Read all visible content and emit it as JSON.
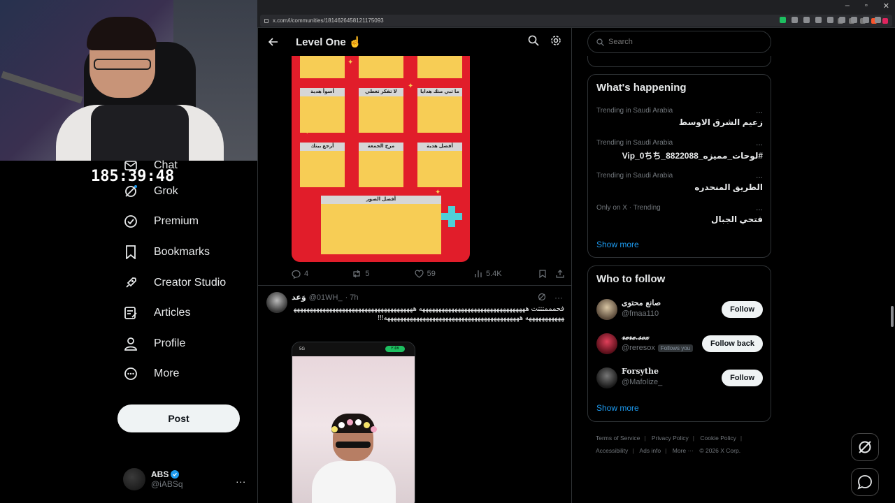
{
  "browser": {
    "url": "x.com/i/communities/1814626458121175093",
    "window_controls": [
      "–",
      "▫",
      "✕"
    ]
  },
  "stream": {
    "timer": "185:39:48"
  },
  "nav": {
    "chat": "Chat",
    "grok": "Grok",
    "premium": "Premium",
    "bookmarks": "Bookmarks",
    "creator_studio": "Creator Studio",
    "articles": "Articles",
    "profile": "Profile",
    "more": "More",
    "post": "Post"
  },
  "account": {
    "display_name": "ABS",
    "handle": "@iABSq",
    "more": "..."
  },
  "header": {
    "title": "Level One ☝️"
  },
  "post1": {
    "cells": [
      "أسوأ هدية",
      "لا تفكر تغطي",
      "ما تبي منك هدايا",
      "أرجع بيتك",
      "مرح الجمعة",
      "أفضل هدية",
      "أفضل الصور"
    ],
    "replies": "4",
    "reposts": "5",
    "likes": "59",
    "views": "5.4K"
  },
  "post2": {
    "name": "وَعد",
    "handle": "@01WH_",
    "time": "· 7h",
    "text": "فحمممتتتت هههههههههههههههههههههههههههههههههه هههههههههههههههههههههههههههههههههههههههههههههههههه ههههههههههههههههههههههههههههههههههههههههههه!!!",
    "phone_signal": "5G",
    "phone_pill": "٢:٥٧"
  },
  "search": {
    "placeholder": "Search"
  },
  "trending": {
    "title": "What's happening",
    "items": [
      {
        "context": "Trending in Saudi Arabia",
        "topic": "زعيم الشرق الاوسط"
      },
      {
        "context": "Trending in Saudi Arabia",
        "topic": "#لوحات_مميزه_8822088_Vip_0ちち"
      },
      {
        "context": "Trending in Saudi Arabia",
        "topic": "الطريق المنحدره"
      },
      {
        "context": "Only on X · Trending",
        "topic": "فتحي الجبال"
      }
    ],
    "more_dots": "...",
    "show_more": "Show more"
  },
  "who_to_follow": {
    "title": "Who to follow",
    "items": [
      {
        "name": "صانع محتوى",
        "handle": "@fmaa110",
        "button": "Follow",
        "follows_you": ""
      },
      {
        "name": "𝓻𝓮𝓻𝓮.𝓼𝓸𝔁",
        "handle": "@reresox",
        "button": "Follow back",
        "follows_you": "Follows you"
      },
      {
        "name": "Forsythe",
        "handle": "@Mafolize_",
        "button": "Follow",
        "follows_you": ""
      }
    ],
    "show_more": "Show more"
  },
  "footer": {
    "links": [
      "Terms of Service",
      "Privacy Policy",
      "Cookie Policy",
      "Accessibility",
      "Ads info",
      "More ···",
      "© 2026 X Corp."
    ]
  },
  "colors": {
    "accent": "#1d9bf0",
    "background": "#000000",
    "border": "#2f3336",
    "muted": "#71767b",
    "post_red": "#e11d2a",
    "cell_yellow": "#f7cd55"
  }
}
